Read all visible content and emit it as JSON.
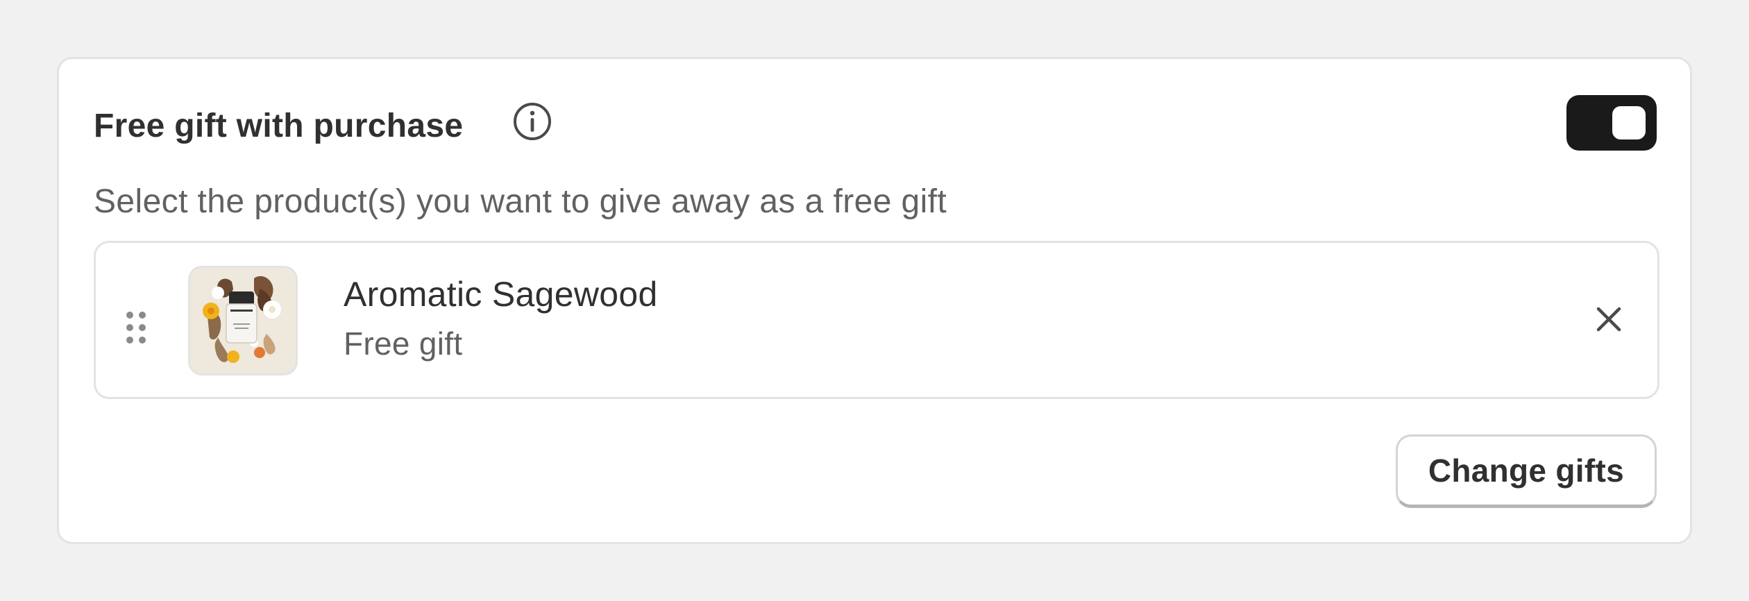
{
  "section": {
    "title": "Free gift with purchase",
    "info_icon": "info-icon",
    "toggle": {
      "state": "on",
      "color": "#1a1a1a"
    },
    "subtitle": "Select the product(s) you want to give away as a free gift"
  },
  "gifts": [
    {
      "name": "Aromatic Sagewood",
      "label": "Free gift",
      "thumbnail_icon": "product-image",
      "drag_icon": "drag-handle-icon",
      "remove_icon": "close-icon"
    }
  ],
  "actions": {
    "change_label": "Change gifts"
  },
  "colors": {
    "text_primary": "#303030",
    "text_secondary": "#616161",
    "border": "#e3e3e3",
    "toggle_on": "#1a1a1a"
  }
}
